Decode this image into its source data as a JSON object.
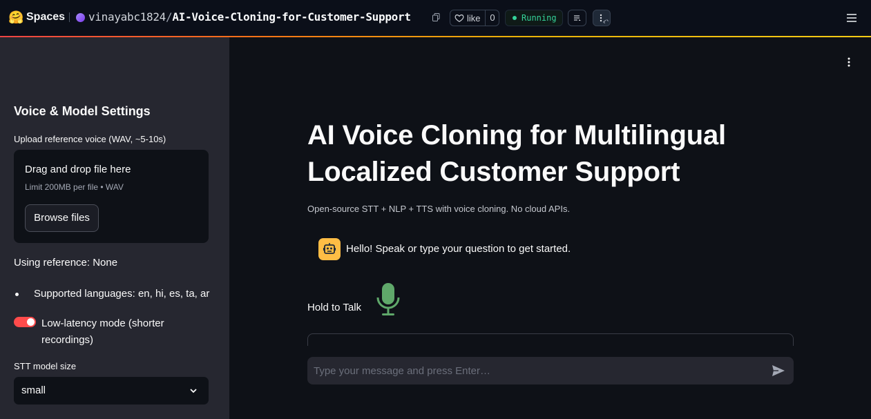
{
  "header": {
    "logo_emoji": "🤗",
    "spaces_label": "Spaces",
    "owner": "vinayabc1824",
    "slash": "/",
    "repo_name": "AI-Voice-Cloning-for-Customer-Support",
    "like_label": "like",
    "like_count": "0",
    "status": "Running",
    "status_color": "#34d399",
    "accent_gradient": [
      "#ef4444",
      "#f97316",
      "#eab308",
      "#facc15"
    ]
  },
  "sidebar": {
    "title": "Voice & Model Settings",
    "upload_label": "Upload reference voice (WAV, ~5-10s)",
    "dropzone": {
      "title": "Drag and drop file here",
      "limit": "Limit 200MB per file • WAV",
      "browse_label": "Browse files"
    },
    "using_reference": "Using reference: None",
    "supported_languages": "Supported languages: en, hi, es, ta, ar",
    "low_latency": {
      "label": "Low-latency mode (shorter recordings)",
      "enabled": true,
      "color": "#ff4b4b"
    },
    "stt_model": {
      "label": "STT model size",
      "selected": "small"
    }
  },
  "main": {
    "title": "AI Voice Cloning for Multilingual Localized Customer Support",
    "subtitle": "Open-source STT + NLP + TTS with voice cloning. No cloud APIs.",
    "assistant_message": "Hello! Speak or type your question to get started.",
    "assistant_avatar_color": "#ffbd45",
    "hold_to_talk": "Hold to Talk",
    "mic_color": "#5fa86a",
    "chat_input": {
      "placeholder": "Type your message and press Enter…",
      "value": ""
    }
  },
  "icons": {
    "copy": "copy-icon",
    "heart": "heart-icon",
    "logs": "logs-icon",
    "more": "more-vertical-icon",
    "menu": "hamburger-menu-icon",
    "kebab": "kebab-menu-icon",
    "robot": "robot-icon",
    "microphone": "microphone-icon",
    "send": "send-icon",
    "chevron": "chevron-down-icon"
  }
}
